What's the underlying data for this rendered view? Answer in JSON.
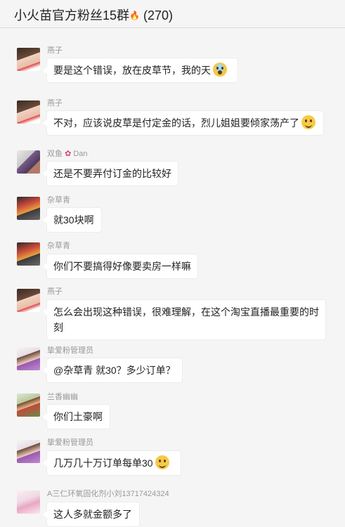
{
  "header": {
    "title": "小火苗官方粉丝15群",
    "count": "(270)"
  },
  "messages": [
    {
      "sender": "燕子",
      "text": "要是这个错误，放在皮草节，我的天",
      "emoji": "scream-emoji"
    },
    {
      "sender": "燕子",
      "text": "不对，应该说皮草是付定金的话，烈儿姐姐要倾家荡产了",
      "emoji": "shy-emoji"
    },
    {
      "sender": "双鱼",
      "sender_suffix": "Dan",
      "text": "还是不要弄付订金的比较好"
    },
    {
      "sender": "杂草青",
      "text": "就30块啊"
    },
    {
      "sender": "杂草青",
      "text": "你们不要搞得好像要卖房一样嘛"
    },
    {
      "sender": "燕子",
      "text": "怎么会出现这种错误，很难理解，在这个淘宝直播最重要的时",
      "text_line2": "刻"
    },
    {
      "sender": "挚爱粉管理员",
      "text": "@杂草青 就30？多少订单？"
    },
    {
      "sender": "兰香幽幽",
      "text": "你们土豪啊"
    },
    {
      "sender": "挚爱粉管理员",
      "text": "几万几十万订单每单30",
      "emoji": "smile-emoji"
    },
    {
      "sender": "A三仁环氧固化剂小刘13717424324",
      "text": "这人多就金额多了"
    }
  ],
  "colors": {
    "background": "#f5f5f5",
    "bubble": "#ffffff",
    "sender_text": "#999999"
  }
}
